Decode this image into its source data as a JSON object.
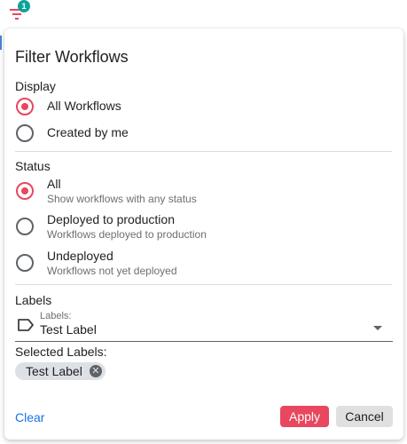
{
  "filter_button": {
    "badge_count": "1"
  },
  "panel": {
    "title": "Filter Workflows",
    "display": {
      "heading": "Display",
      "options": [
        {
          "label": "All Workflows",
          "checked": true
        },
        {
          "label": "Created by me",
          "checked": false
        }
      ]
    },
    "status": {
      "heading": "Status",
      "options": [
        {
          "label": "All",
          "description": "Show workflows with any status",
          "checked": true
        },
        {
          "label": "Deployed to production",
          "description": "Workflows deployed to production",
          "checked": false
        },
        {
          "label": "Undeployed",
          "description": "Workflows not yet deployed",
          "checked": false
        }
      ]
    },
    "labels": {
      "heading": "Labels",
      "field_caption": "Labels:",
      "field_value": "Test Label",
      "selected_heading": "Selected Labels:",
      "selected": [
        "Test Label"
      ]
    },
    "actions": {
      "clear": "Clear",
      "apply": "Apply",
      "cancel": "Cancel"
    }
  },
  "colors": {
    "accent": "#e8475f",
    "badge": "#0fa39a",
    "link": "#1a73e8",
    "chip": "#dde1e6"
  }
}
